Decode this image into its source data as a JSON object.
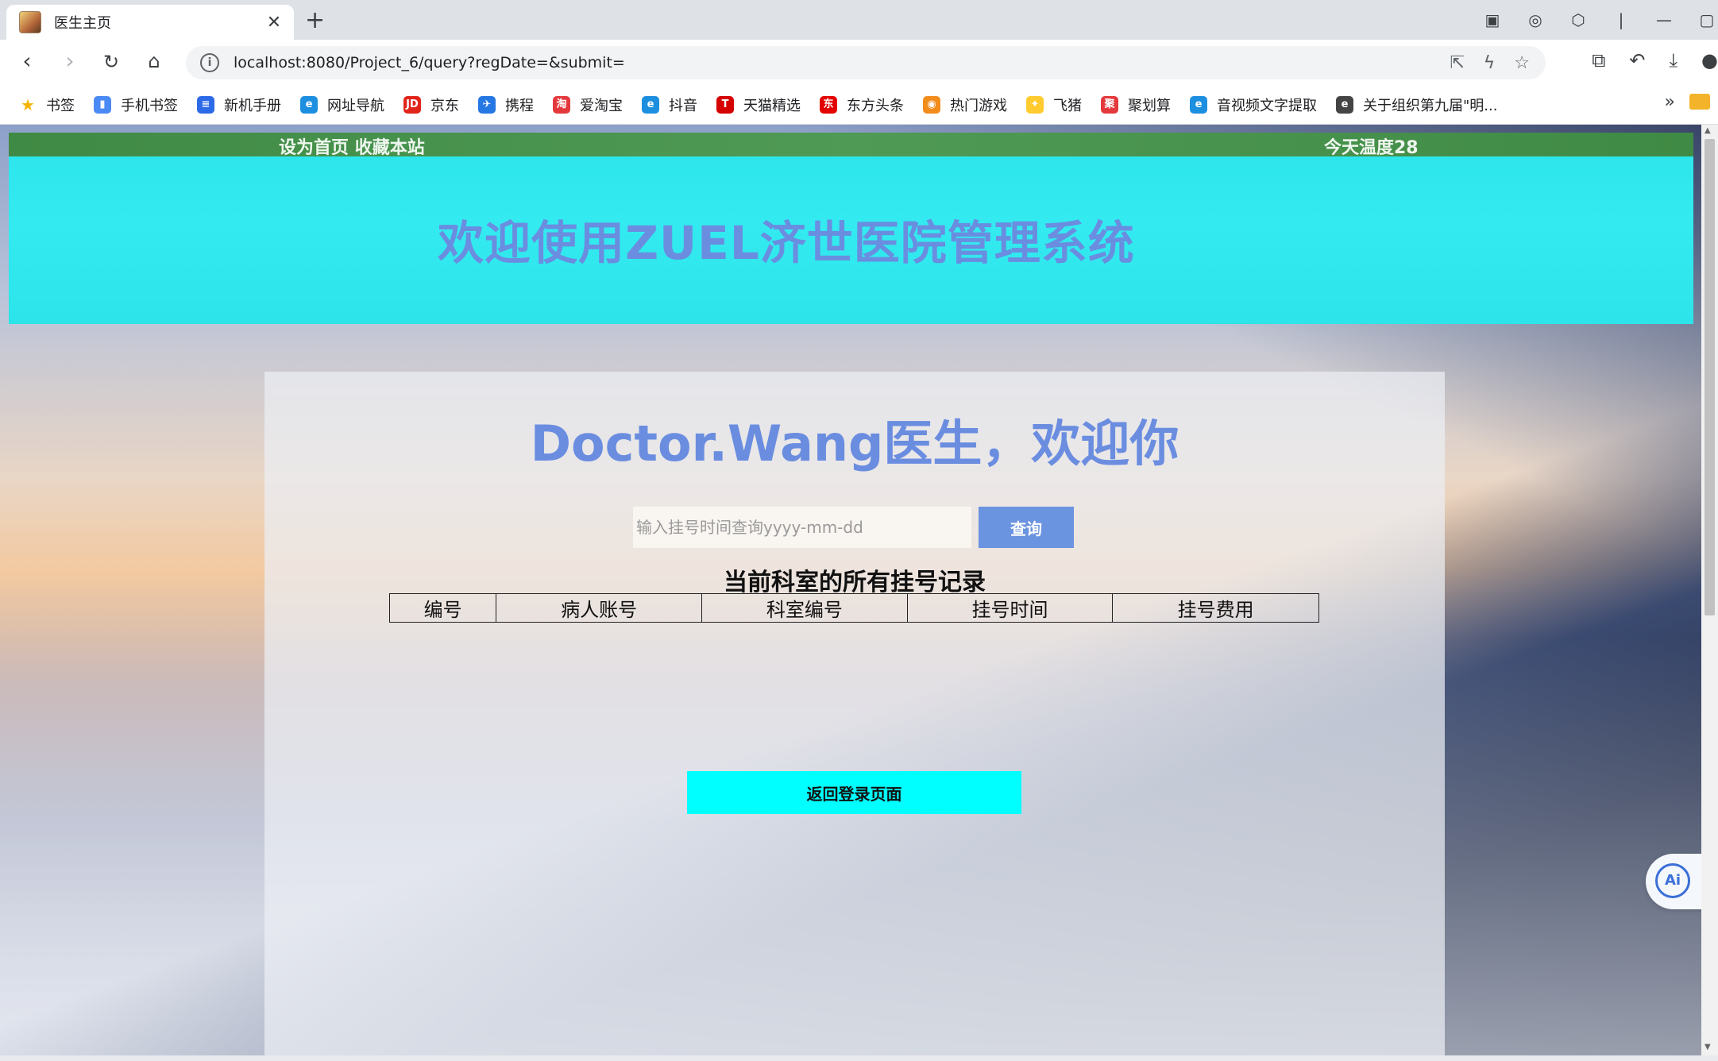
{
  "browser": {
    "tab_title": "医生主页",
    "tab_close": "✕",
    "new_tab": "+",
    "url": "localhost:8080/Project_6/query?regDate=&submit=",
    "bookmarks": [
      {
        "label": "书签",
        "icon": "star-icon",
        "color": "#f4b400"
      },
      {
        "label": "手机书签",
        "icon": "phone-icon",
        "color": "#4a8af4"
      },
      {
        "label": "新机手册",
        "icon": "doc-icon",
        "color": "#2d6ae8"
      },
      {
        "label": "网址导航",
        "icon": "e-icon",
        "color": "#1d8fe0"
      },
      {
        "label": "京东",
        "icon": "jd-icon",
        "color": "#e1251b"
      },
      {
        "label": "携程",
        "icon": "ctrip-icon",
        "color": "#2577e3"
      },
      {
        "label": "爱淘宝",
        "icon": "taobao-icon",
        "color": "#e4393c"
      },
      {
        "label": "抖音",
        "icon": "e-icon",
        "color": "#1d8fe0"
      },
      {
        "label": "天猫精选",
        "icon": "tmall-icon",
        "color": "#d50000"
      },
      {
        "label": "东方头条",
        "icon": "dftt-icon",
        "color": "#e30000"
      },
      {
        "label": "热门游戏",
        "icon": "game-icon",
        "color": "#f28c1b"
      },
      {
        "label": "飞猪",
        "icon": "fliggy-icon",
        "color": "#ffcb2f"
      },
      {
        "label": "聚划算",
        "icon": "ju-icon",
        "color": "#e4393c"
      },
      {
        "label": "音视频文字提取",
        "icon": "e-icon",
        "color": "#1d8fe0"
      },
      {
        "label": "关于组织第九届\"明...",
        "icon": "e-icon",
        "color": "#444444"
      }
    ],
    "bookmark_more": "»"
  },
  "page": {
    "topbar_left": [
      "设为首页",
      "收藏本站"
    ],
    "topbar_right": "今天温度28",
    "banner_title": "欢迎使用ZUEL济世医院管理系统",
    "welcome": "Doctor.Wang医生，欢迎你",
    "search": {
      "placeholder": "输入挂号时间查询yyyy-mm-dd",
      "value": "",
      "button": "查询"
    },
    "records_title": "当前科室的所有挂号记录",
    "table_headers": [
      "编号",
      "病人账号",
      "科室编号",
      "挂号时间",
      "挂号费用"
    ],
    "back_button": "返回登录页面",
    "ai_button": "Ai"
  }
}
